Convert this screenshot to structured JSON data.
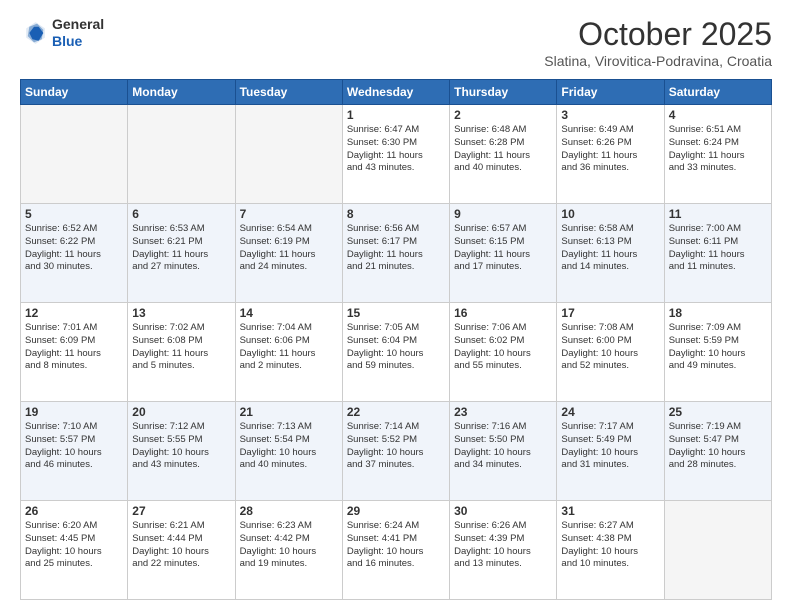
{
  "header": {
    "logo_general": "General",
    "logo_blue": "Blue",
    "month_title": "October 2025",
    "location": "Slatina, Virovitica-Podravina, Croatia"
  },
  "weekdays": [
    "Sunday",
    "Monday",
    "Tuesday",
    "Wednesday",
    "Thursday",
    "Friday",
    "Saturday"
  ],
  "weeks": [
    [
      {
        "day": "",
        "info": ""
      },
      {
        "day": "",
        "info": ""
      },
      {
        "day": "",
        "info": ""
      },
      {
        "day": "1",
        "info": "Sunrise: 6:47 AM\nSunset: 6:30 PM\nDaylight: 11 hours\nand 43 minutes."
      },
      {
        "day": "2",
        "info": "Sunrise: 6:48 AM\nSunset: 6:28 PM\nDaylight: 11 hours\nand 40 minutes."
      },
      {
        "day": "3",
        "info": "Sunrise: 6:49 AM\nSunset: 6:26 PM\nDaylight: 11 hours\nand 36 minutes."
      },
      {
        "day": "4",
        "info": "Sunrise: 6:51 AM\nSunset: 6:24 PM\nDaylight: 11 hours\nand 33 minutes."
      }
    ],
    [
      {
        "day": "5",
        "info": "Sunrise: 6:52 AM\nSunset: 6:22 PM\nDaylight: 11 hours\nand 30 minutes."
      },
      {
        "day": "6",
        "info": "Sunrise: 6:53 AM\nSunset: 6:21 PM\nDaylight: 11 hours\nand 27 minutes."
      },
      {
        "day": "7",
        "info": "Sunrise: 6:54 AM\nSunset: 6:19 PM\nDaylight: 11 hours\nand 24 minutes."
      },
      {
        "day": "8",
        "info": "Sunrise: 6:56 AM\nSunset: 6:17 PM\nDaylight: 11 hours\nand 21 minutes."
      },
      {
        "day": "9",
        "info": "Sunrise: 6:57 AM\nSunset: 6:15 PM\nDaylight: 11 hours\nand 17 minutes."
      },
      {
        "day": "10",
        "info": "Sunrise: 6:58 AM\nSunset: 6:13 PM\nDaylight: 11 hours\nand 14 minutes."
      },
      {
        "day": "11",
        "info": "Sunrise: 7:00 AM\nSunset: 6:11 PM\nDaylight: 11 hours\nand 11 minutes."
      }
    ],
    [
      {
        "day": "12",
        "info": "Sunrise: 7:01 AM\nSunset: 6:09 PM\nDaylight: 11 hours\nand 8 minutes."
      },
      {
        "day": "13",
        "info": "Sunrise: 7:02 AM\nSunset: 6:08 PM\nDaylight: 11 hours\nand 5 minutes."
      },
      {
        "day": "14",
        "info": "Sunrise: 7:04 AM\nSunset: 6:06 PM\nDaylight: 11 hours\nand 2 minutes."
      },
      {
        "day": "15",
        "info": "Sunrise: 7:05 AM\nSunset: 6:04 PM\nDaylight: 10 hours\nand 59 minutes."
      },
      {
        "day": "16",
        "info": "Sunrise: 7:06 AM\nSunset: 6:02 PM\nDaylight: 10 hours\nand 55 minutes."
      },
      {
        "day": "17",
        "info": "Sunrise: 7:08 AM\nSunset: 6:00 PM\nDaylight: 10 hours\nand 52 minutes."
      },
      {
        "day": "18",
        "info": "Sunrise: 7:09 AM\nSunset: 5:59 PM\nDaylight: 10 hours\nand 49 minutes."
      }
    ],
    [
      {
        "day": "19",
        "info": "Sunrise: 7:10 AM\nSunset: 5:57 PM\nDaylight: 10 hours\nand 46 minutes."
      },
      {
        "day": "20",
        "info": "Sunrise: 7:12 AM\nSunset: 5:55 PM\nDaylight: 10 hours\nand 43 minutes."
      },
      {
        "day": "21",
        "info": "Sunrise: 7:13 AM\nSunset: 5:54 PM\nDaylight: 10 hours\nand 40 minutes."
      },
      {
        "day": "22",
        "info": "Sunrise: 7:14 AM\nSunset: 5:52 PM\nDaylight: 10 hours\nand 37 minutes."
      },
      {
        "day": "23",
        "info": "Sunrise: 7:16 AM\nSunset: 5:50 PM\nDaylight: 10 hours\nand 34 minutes."
      },
      {
        "day": "24",
        "info": "Sunrise: 7:17 AM\nSunset: 5:49 PM\nDaylight: 10 hours\nand 31 minutes."
      },
      {
        "day": "25",
        "info": "Sunrise: 7:19 AM\nSunset: 5:47 PM\nDaylight: 10 hours\nand 28 minutes."
      }
    ],
    [
      {
        "day": "26",
        "info": "Sunrise: 6:20 AM\nSunset: 4:45 PM\nDaylight: 10 hours\nand 25 minutes."
      },
      {
        "day": "27",
        "info": "Sunrise: 6:21 AM\nSunset: 4:44 PM\nDaylight: 10 hours\nand 22 minutes."
      },
      {
        "day": "28",
        "info": "Sunrise: 6:23 AM\nSunset: 4:42 PM\nDaylight: 10 hours\nand 19 minutes."
      },
      {
        "day": "29",
        "info": "Sunrise: 6:24 AM\nSunset: 4:41 PM\nDaylight: 10 hours\nand 16 minutes."
      },
      {
        "day": "30",
        "info": "Sunrise: 6:26 AM\nSunset: 4:39 PM\nDaylight: 10 hours\nand 13 minutes."
      },
      {
        "day": "31",
        "info": "Sunrise: 6:27 AM\nSunset: 4:38 PM\nDaylight: 10 hours\nand 10 minutes."
      },
      {
        "day": "",
        "info": ""
      }
    ]
  ]
}
